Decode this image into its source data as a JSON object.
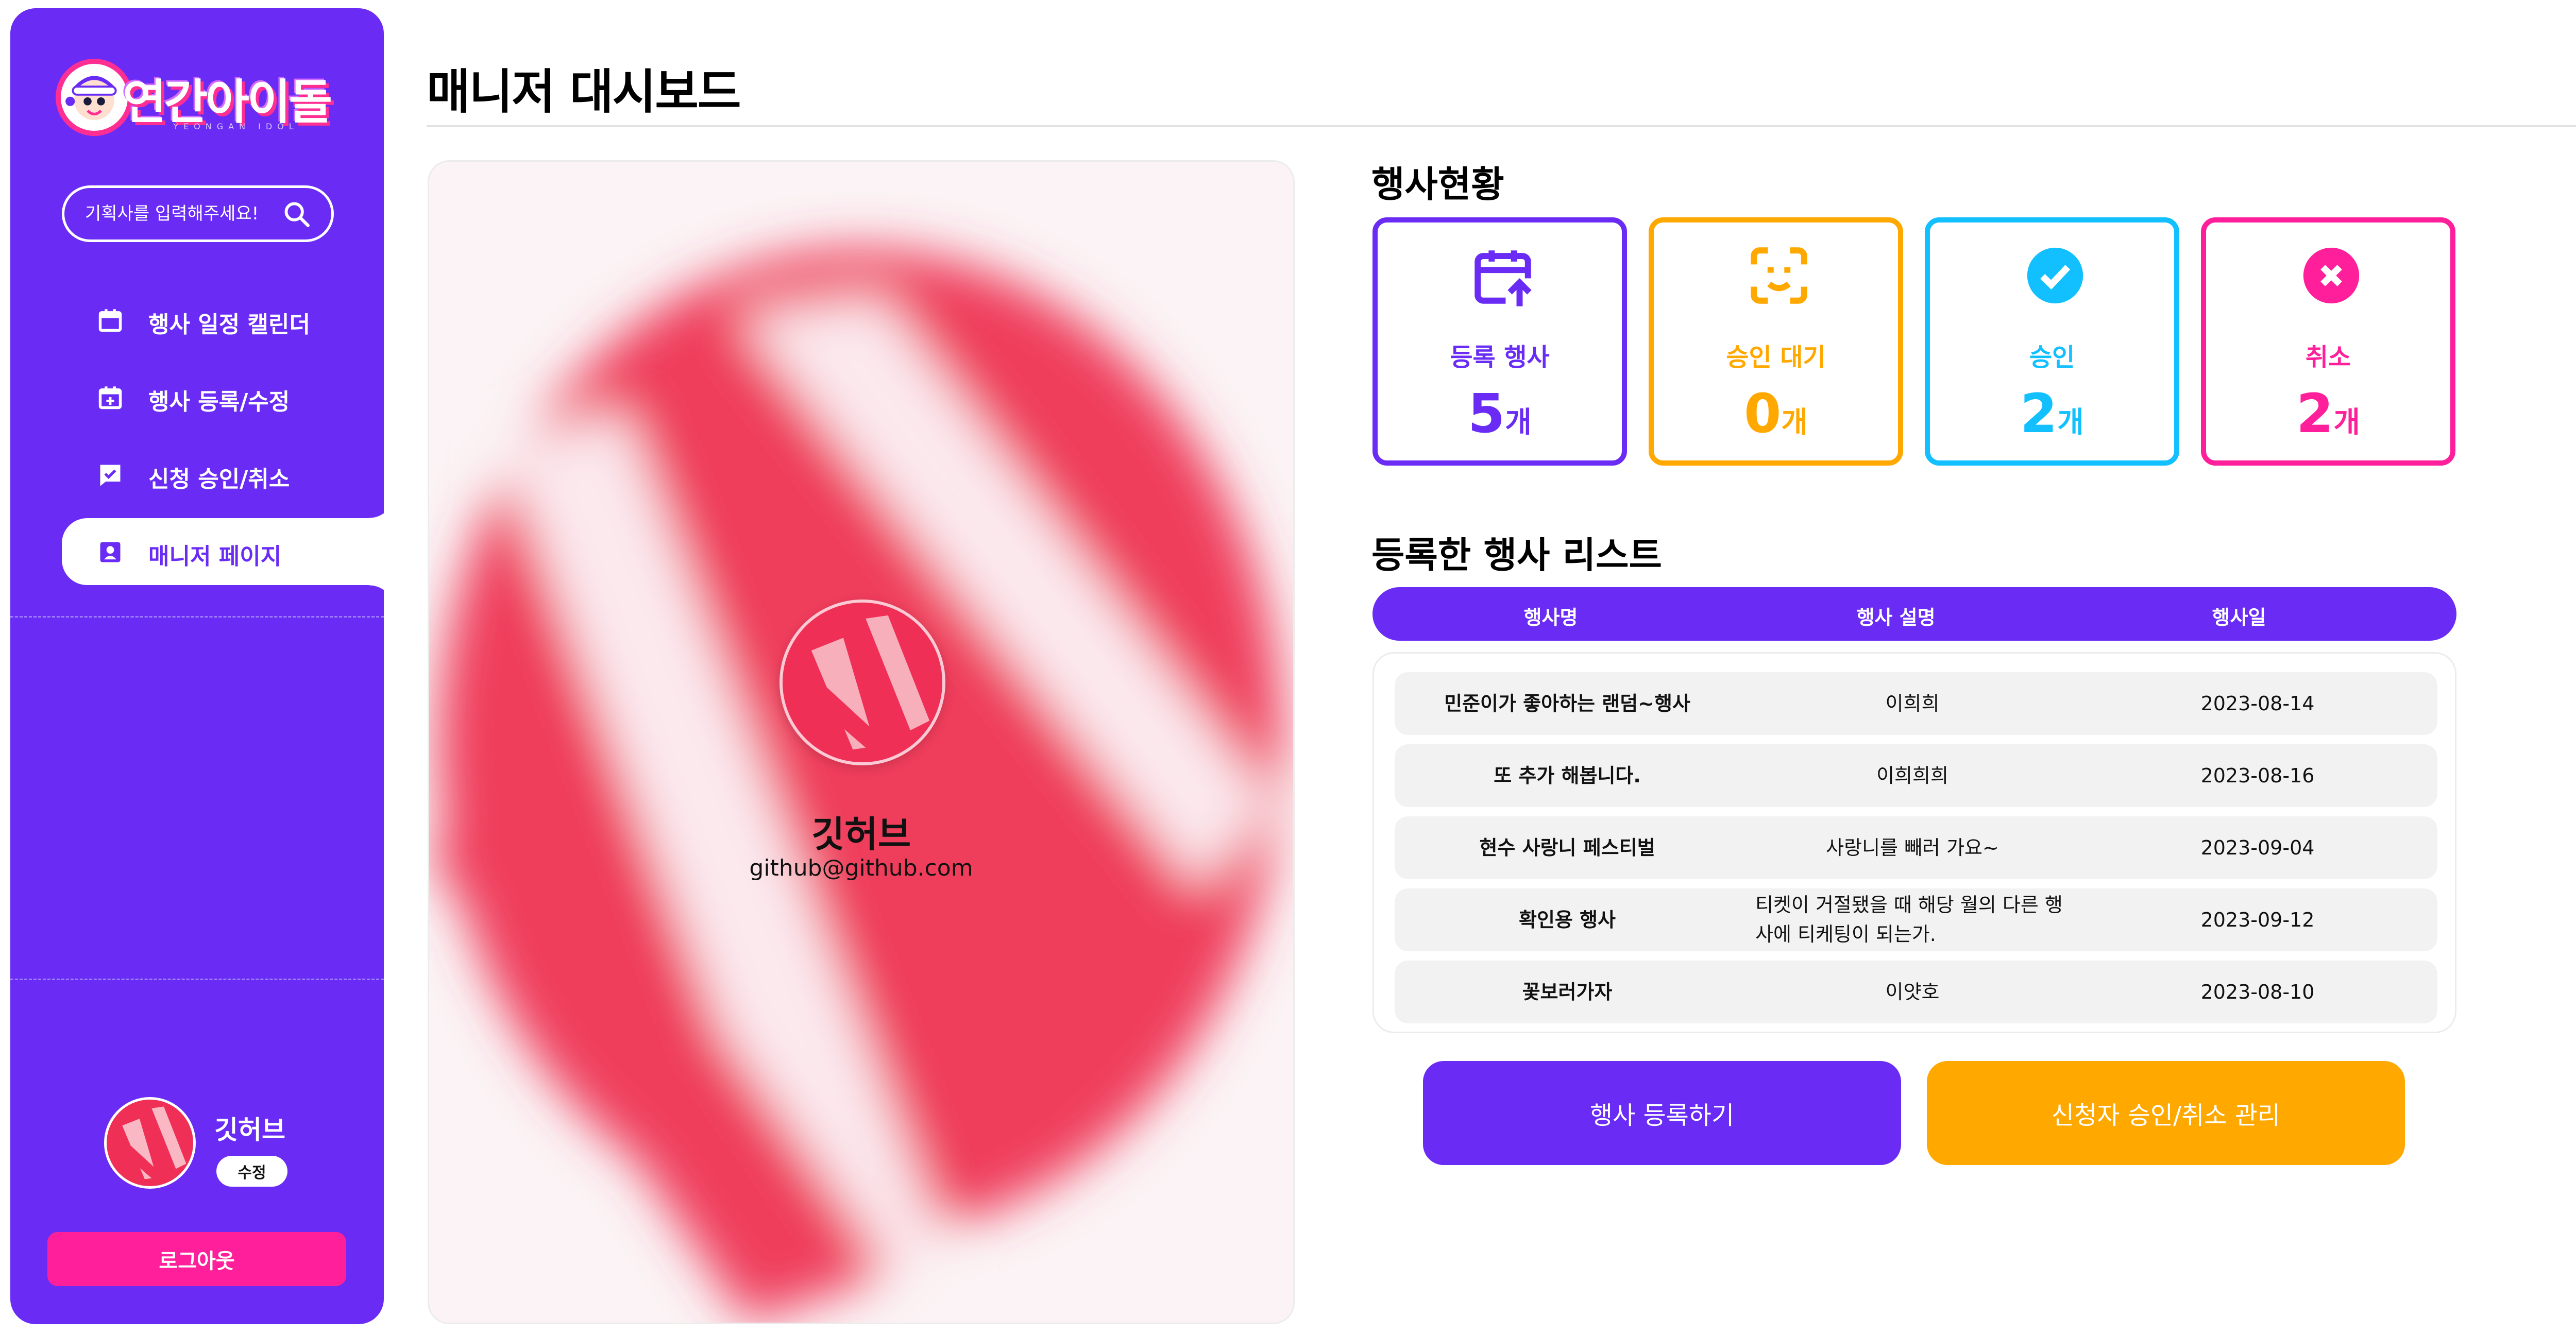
{
  "app": {
    "logo_text": "연간아이돌",
    "logo_sub": "YEONGAN IDOL"
  },
  "sidebar": {
    "search_placeholder": "기획사를 입력해주세요!",
    "items": [
      {
        "label": "행사 일정 캘린더",
        "icon": "calendar-icon"
      },
      {
        "label": "행사 등록/수정",
        "icon": "calendar-plus-icon"
      },
      {
        "label": "신청 승인/취소",
        "icon": "check-chat-icon"
      },
      {
        "label": "매니저 페이지",
        "icon": "profile-badge-icon",
        "active": true
      }
    ],
    "user_name": "깃허브",
    "edit_label": "수정",
    "logout_label": "로그아웃"
  },
  "main": {
    "title": "매니저 대시보드",
    "profile": {
      "name": "깃허브",
      "email": "github@github.com"
    },
    "stats_title": "행사현황",
    "stats": [
      {
        "label": "등록 행사",
        "value": "5",
        "unit": "개",
        "color": "#6a2cf5",
        "icon": "calendar-upload-icon"
      },
      {
        "label": "승인 대기",
        "value": "0",
        "unit": "개",
        "color": "#ffa800",
        "icon": "face-scan-icon"
      },
      {
        "label": "승인",
        "value": "2",
        "unit": "개",
        "color": "#12c0ff",
        "icon": "check-circle-icon"
      },
      {
        "label": "취소",
        "value": "2",
        "unit": "개",
        "color": "#ff1f9a",
        "icon": "x-circle-icon"
      }
    ],
    "list_title": "등록한 행사 리스트",
    "columns": [
      "행사명",
      "행사 설명",
      "행사일"
    ],
    "events": [
      {
        "name": "민준이가 좋아하는 랜덤~행사",
        "desc": "이희희",
        "date": "2023-08-14"
      },
      {
        "name": "또 추가 해봅니다.",
        "desc": "이희희희",
        "date": "2023-08-16"
      },
      {
        "name": "현수 사랑니 페스티벌",
        "desc": "사랑니를 빼러 가요~",
        "date": "2023-09-04"
      },
      {
        "name": "확인용 행사",
        "desc": "티켓이 거절됐을 때 해당 월의 다른 행사에 티케팅이 되는가.",
        "date": "2023-09-12"
      },
      {
        "name": "꽃보러가자",
        "desc": "이얏호",
        "date": "2023-08-10"
      }
    ],
    "register_button": "행사 등록하기",
    "manage_button": "신청자 승인/취소 관리",
    "colors": {
      "primary": "#6a2cf5",
      "accent": "#ffa800",
      "pink": "#ff1f9a"
    }
  }
}
